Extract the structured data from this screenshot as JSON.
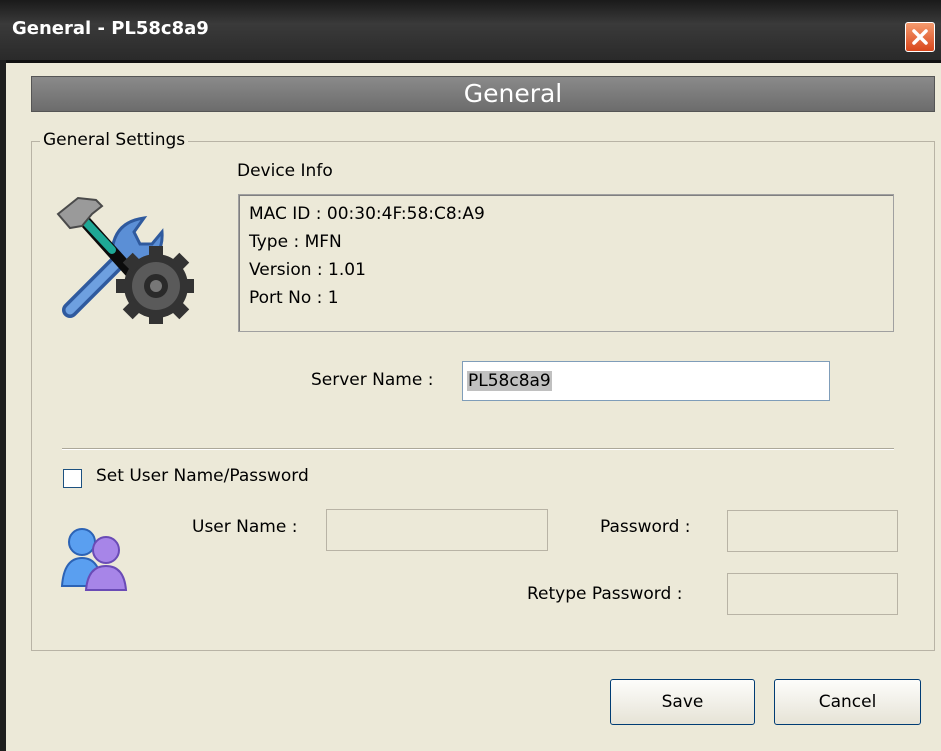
{
  "window": {
    "title": "General - PL58c8a9"
  },
  "banner": {
    "title": "General"
  },
  "general_settings": {
    "group_label": "General Settings",
    "device_info": {
      "heading": "Device Info",
      "mac_id": "MAC ID : 00:30:4F:58:C8:A9",
      "type": "Type : MFN",
      "version": "Version : 1.01",
      "port_no": "Port No : 1"
    },
    "server_name": {
      "label": "Server Name :",
      "value": "PL58c8a9"
    },
    "credentials": {
      "checkbox_label": "Set User Name/Password",
      "checked": false,
      "user_name_label": "User Name :",
      "user_name_value": "",
      "password_label": "Password :",
      "password_value": "",
      "retype_password_label": "Retype Password :",
      "retype_password_value": ""
    }
  },
  "buttons": {
    "save": "Save",
    "cancel": "Cancel"
  },
  "icons": {
    "device": "tools-gear-icon",
    "users": "users-icon",
    "close": "close-icon"
  },
  "colors": {
    "background": "#ece9d8",
    "titlebar": "#2a2a2a",
    "banner": "#7a7a7a",
    "close": "#d9471c"
  }
}
